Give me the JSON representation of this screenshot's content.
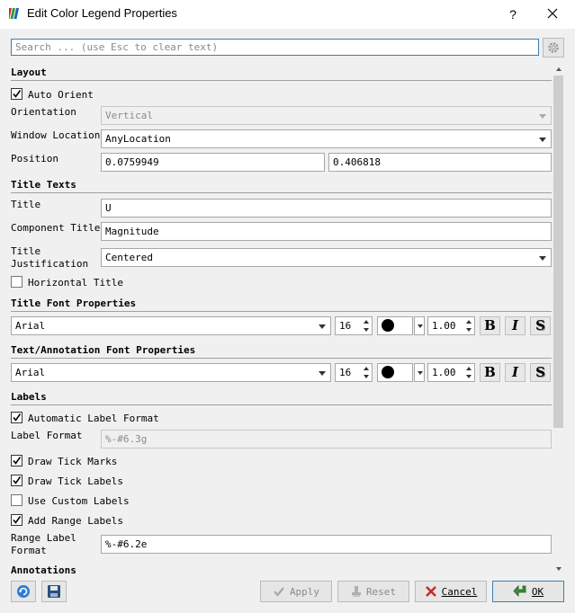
{
  "window": {
    "title": "Edit Color Legend Properties",
    "help": "?",
    "app_icon": "paraview-logo-icon",
    "close_icon": "close-icon"
  },
  "search": {
    "placeholder": "Search ... (use Esc to clear text)",
    "value": "",
    "settings_icon": "gear-icon"
  },
  "layout": {
    "header": "Layout",
    "auto_orient": {
      "label": "Auto Orient",
      "checked": true
    },
    "orientation": {
      "label": "Orientation",
      "value": "Vertical",
      "enabled": false
    },
    "window_location": {
      "label": "Window Location",
      "value": "AnyLocation"
    },
    "position": {
      "label": "Position",
      "x": "0.0759949",
      "y": "0.406818"
    }
  },
  "title_texts": {
    "header": "Title Texts",
    "title": {
      "label": "Title",
      "value": "U"
    },
    "component_title": {
      "label": "Component Title",
      "value": "Magnitude"
    },
    "title_justification": {
      "label_line1": "Title",
      "label_line2": "Justification",
      "value": "Centered"
    },
    "horizontal_title": {
      "label": "Horizontal Title",
      "checked": false
    }
  },
  "title_font": {
    "header": "Title Font Properties",
    "family": "Arial",
    "size": "16",
    "color": "#000000",
    "opacity": "1.00",
    "bold": "B",
    "italic": "I",
    "shadow": "S"
  },
  "annotation_font": {
    "header": "Text/Annotation Font Properties",
    "family": "Arial",
    "size": "16",
    "color": "#000000",
    "opacity": "1.00",
    "bold": "B",
    "italic": "I",
    "shadow": "S"
  },
  "labels": {
    "header": "Labels",
    "automatic_label_format": {
      "label": "Automatic Label Format",
      "checked": true
    },
    "label_format": {
      "label": "Label Format",
      "value": "%-#6.3g",
      "enabled": false
    },
    "draw_tick_marks": {
      "label": "Draw Tick Marks",
      "checked": true
    },
    "draw_tick_labels": {
      "label": "Draw Tick Labels",
      "checked": true
    },
    "use_custom_labels": {
      "label": "Use Custom Labels",
      "checked": false
    },
    "add_range_labels": {
      "label": "Add Range Labels",
      "checked": true
    },
    "range_label_format": {
      "label_line1": "Range Label",
      "label_line2": "Format",
      "value": "%-#6.2e"
    }
  },
  "annotations": {
    "header": "Annotations"
  },
  "buttons": {
    "restore_icon": "refresh-icon",
    "save_icon": "save-icon",
    "apply": "Apply",
    "reset": "Reset",
    "cancel": "Cancel",
    "ok": "OK"
  },
  "colors": {
    "accent": "#3c7fb1",
    "background": "#f0f0f0"
  }
}
